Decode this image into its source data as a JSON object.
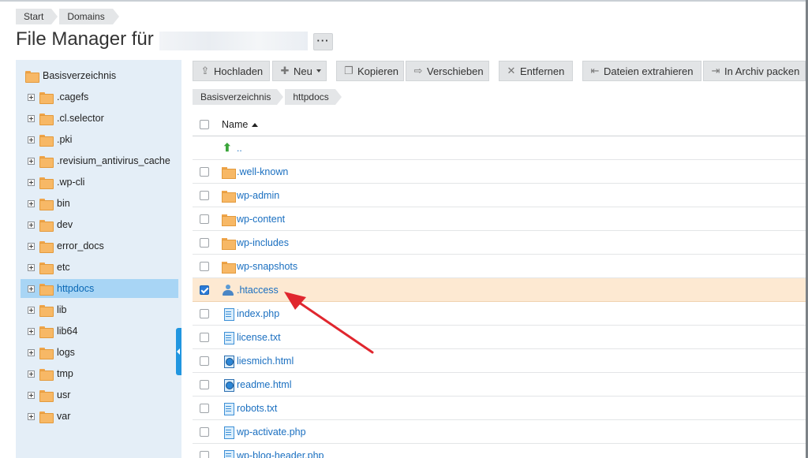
{
  "breadcrumb": [
    "Start",
    "Domains"
  ],
  "page": {
    "title": "File Manager für",
    "more_label": "···"
  },
  "tree": {
    "root": "Basisverzeichnis",
    "items": [
      ".cagefs",
      ".cl.selector",
      ".pki",
      ".revisium_antivirus_cache",
      ".wp-cli",
      "bin",
      "dev",
      "error_docs",
      "etc",
      "httpdocs",
      "lib",
      "lib64",
      "logs",
      "tmp",
      "usr",
      "var"
    ],
    "selected": "httpdocs"
  },
  "toolbar": {
    "upload": "Hochladen",
    "new": "Neu",
    "copy": "Kopieren",
    "move": "Verschieben",
    "remove": "Entfernen",
    "extract": "Dateien extrahieren",
    "archive": "In Archiv packen"
  },
  "path": [
    "Basisverzeichnis",
    "httpdocs"
  ],
  "list": {
    "column_name": "Name",
    "up_label": "..",
    "files": [
      {
        "name": ".well-known",
        "icon": "folder-icon"
      },
      {
        "name": "wp-admin",
        "icon": "folder-icon"
      },
      {
        "name": "wp-content",
        "icon": "folder-icon"
      },
      {
        "name": "wp-includes",
        "icon": "folder-icon"
      },
      {
        "name": "wp-snapshots",
        "icon": "folder-icon"
      },
      {
        "name": ".htaccess",
        "icon": "user-file-icon"
      },
      {
        "name": "index.php",
        "icon": "php-file-icon"
      },
      {
        "name": "license.txt",
        "icon": "text-file-icon"
      },
      {
        "name": "liesmich.html",
        "icon": "html-file-icon"
      },
      {
        "name": "readme.html",
        "icon": "html-file-icon"
      },
      {
        "name": "robots.txt",
        "icon": "text-file-icon"
      },
      {
        "name": "wp-activate.php",
        "icon": "php-file-icon"
      },
      {
        "name": "wp-blog-header.php",
        "icon": "php-file-icon"
      }
    ],
    "checked": ".htaccess"
  },
  "colors": {
    "accent": "#2196e0",
    "selected_row": "#fde9d2",
    "annotation_arrow": "#e0262e"
  }
}
